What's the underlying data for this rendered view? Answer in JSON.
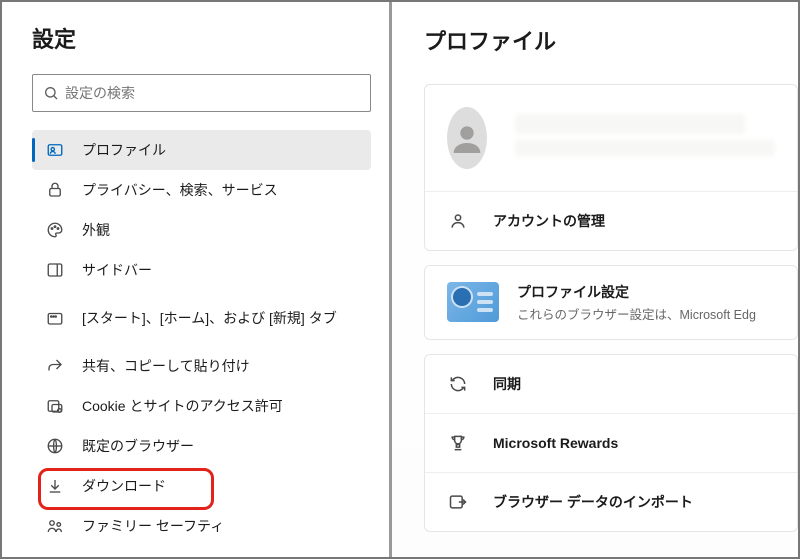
{
  "sidebar": {
    "title": "設定",
    "search_placeholder": "設定の検索",
    "items": [
      {
        "label": "プロファイル"
      },
      {
        "label": "プライバシー、検索、サービス"
      },
      {
        "label": "外観"
      },
      {
        "label": "サイドバー"
      },
      {
        "label": "[スタート]、[ホーム]、および [新規] タブ"
      },
      {
        "label": "共有、コピーして貼り付け"
      },
      {
        "label": "Cookie とサイトのアクセス許可"
      },
      {
        "label": "既定のブラウザー"
      },
      {
        "label": "ダウンロード"
      },
      {
        "label": "ファミリー セーフティ"
      }
    ]
  },
  "main": {
    "title": "プロファイル",
    "account_manage": "アカウントの管理",
    "profile_settings_title": "プロファイル設定",
    "profile_settings_sub": "これらのブラウザー設定は、Microsoft Edg",
    "sync": "同期",
    "rewards": "Microsoft Rewards",
    "import": "ブラウザー データのインポート"
  }
}
